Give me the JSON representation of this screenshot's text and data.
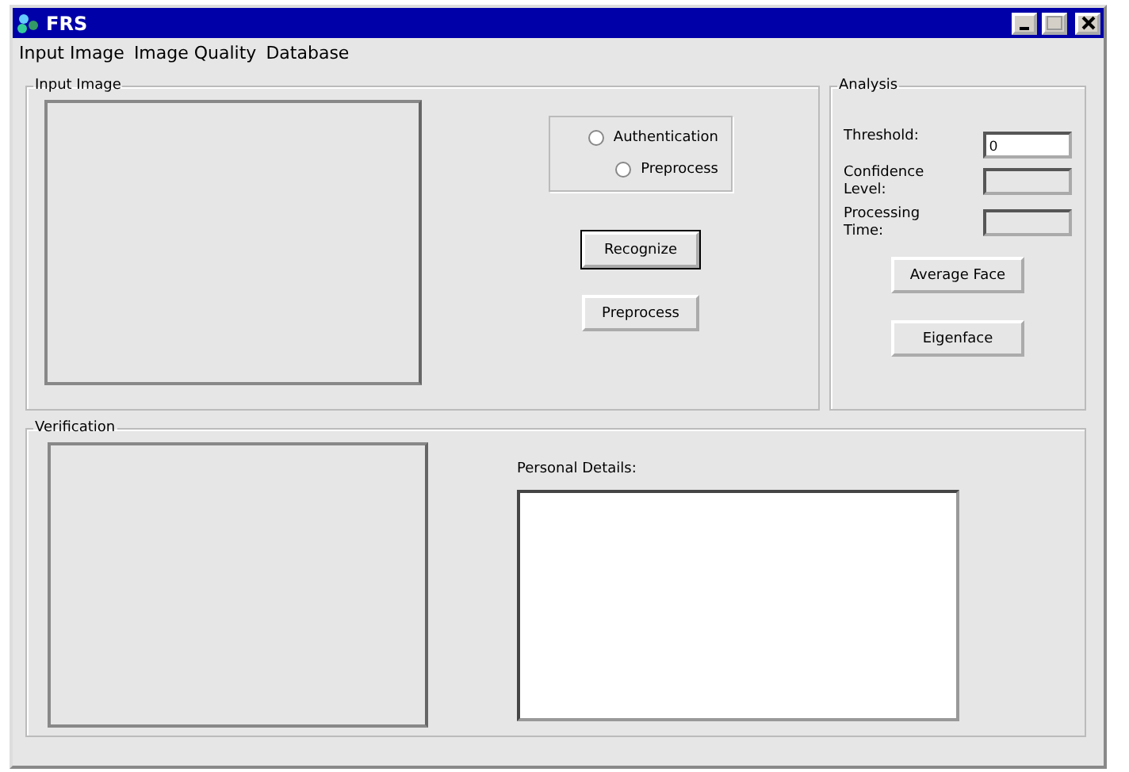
{
  "window": {
    "title": "FRS"
  },
  "menu": [
    "Input Image",
    "Image Quality",
    "Database"
  ],
  "input_image": {
    "title": "Input Image",
    "modes": [
      {
        "label": "Authentication",
        "selected": false
      },
      {
        "label": "Preprocess",
        "selected": false
      }
    ],
    "buttons": [
      {
        "label": "Recognize",
        "default": true
      },
      {
        "label": "Preprocess",
        "default": false
      }
    ]
  },
  "analysis": {
    "title": "Analysis",
    "fields": [
      {
        "label": "Threshold:",
        "value": "0",
        "disabled": false
      },
      {
        "label": "Confidence Level:",
        "disabled": true
      },
      {
        "label": "Processing Time:",
        "disabled": true
      }
    ],
    "buttons": [
      "Average Face",
      "Eigenface"
    ]
  },
  "verification": {
    "title": "Verification",
    "details_label": "Personal Details:"
  }
}
